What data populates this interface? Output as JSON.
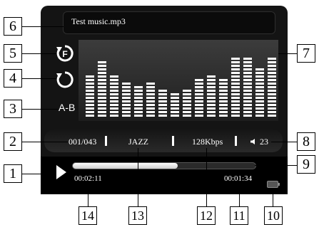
{
  "player": {
    "track_title": "Test music.mp3",
    "ab_label": "A-B",
    "track_counter": "001/043",
    "eq_preset": "JAZZ",
    "bitrate": "128Kbps",
    "volume": "23",
    "elapsed_time": "00:02:11",
    "remaining_time": "00:01:34",
    "progress_fraction": 0.58,
    "equalizer_levels": [
      0.6,
      0.8,
      0.62,
      0.5,
      0.44,
      0.5,
      0.41,
      0.34,
      0.4,
      0.55,
      0.62,
      0.55,
      0.86,
      0.84,
      0.68,
      0.84
    ]
  },
  "callouts": {
    "c1": "1",
    "c2": "2",
    "c3": "3",
    "c4": "4",
    "c5": "5",
    "c6": "6",
    "c7": "7",
    "c8": "8",
    "c9": "9",
    "c10": "10",
    "c11": "11",
    "c12": "12",
    "c13": "13",
    "c14": "14"
  },
  "colors": {
    "screen": "#141414",
    "accent": "#ffffff"
  }
}
